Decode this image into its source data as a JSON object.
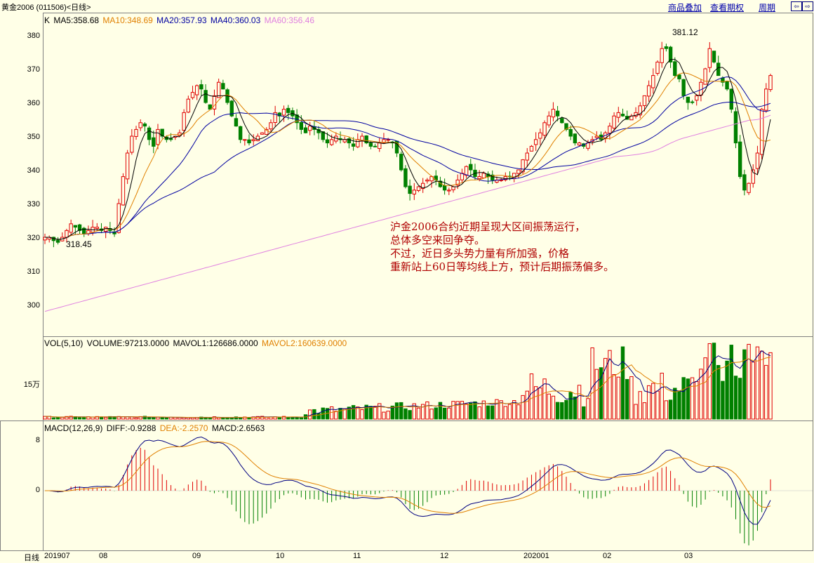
{
  "header": {
    "title": "黄金2006 (011506)<日线>",
    "links": [
      "商品叠加",
      "查看期权",
      "周期"
    ],
    "nav_prev": "⇦",
    "nav_next": "⇨"
  },
  "colors": {
    "background": "#FFFFE7",
    "up": "#E00000",
    "down": "#008000",
    "ma5": "#000000",
    "ma10": "#E08000",
    "ma20": "#0000A0",
    "ma40": "#0000A0",
    "ma60": "#E080E0"
  },
  "price_panel": {
    "legend": {
      "k": "K",
      "ma5": "MA5:358.68",
      "ma10": "MA10:348.69",
      "ma20": "MA20:357.93",
      "ma40": "MA40:360.03",
      "ma60": "MA60:356.46"
    },
    "yticks": [
      "380",
      "370",
      "360",
      "350",
      "340",
      "330",
      "320",
      "310",
      "300"
    ],
    "high_label": "381.12",
    "low_label": "318.45",
    "annotation": [
      "沪金2006合约近期呈现大区间振荡运行，",
      "总体多空来回争夺。",
      "不过，近日多头势力量有所加强，价格",
      "重新站上60日等均线上方，预计后期振荡偏多。"
    ]
  },
  "volume_panel": {
    "legend": {
      "vol": "VOL(5,10)",
      "volume": "VOLUME:97213.0000",
      "mavol1": "MAVOL1:126686.0000",
      "mavol2": "MAVOL2:160639.0000"
    },
    "ytick": "15万"
  },
  "macd_panel": {
    "legend": {
      "macd_name": "MACD(12,26,9)",
      "diff": "DIFF:-0.9288",
      "dea": "DEA:-2.2570",
      "macd": "MACD:2.6563"
    },
    "yticks": [
      "8",
      "0"
    ]
  },
  "xaxis": {
    "period_label": "日线",
    "ticks": [
      "201907",
      "08",
      "09",
      "10",
      "11",
      "12",
      "202001",
      "02",
      "03"
    ]
  },
  "chart_data": {
    "type": "candlestick",
    "ylim": [
      294,
      384
    ],
    "y_ticks": [
      300,
      310,
      320,
      330,
      340,
      350,
      360,
      370,
      380
    ],
    "annotations": {
      "high": 381.12,
      "low": 318.45
    },
    "month_start_index": [
      0,
      17,
      42,
      65,
      87,
      110,
      133,
      154,
      174
    ],
    "last_values": {
      "ma5": 358.68,
      "ma10": 348.69,
      "ma20": 357.93,
      "ma40": 360.03,
      "ma60": 356.46,
      "volume": 97213,
      "mavol1": 126686,
      "mavol2": 160639,
      "diff": -0.9288,
      "dea": -2.257,
      "macd": 2.6563
    },
    "close_path": [
      320,
      320,
      319,
      318.5,
      320,
      322,
      324,
      323,
      322,
      321,
      322,
      323,
      323,
      322,
      323,
      322,
      321,
      330,
      338,
      345,
      350,
      352,
      354,
      353,
      349,
      347,
      352,
      350,
      349,
      349,
      350,
      351,
      357,
      361,
      363,
      365,
      364,
      360,
      358,
      362,
      366,
      364,
      360,
      356,
      353,
      349,
      349,
      348,
      349,
      350,
      351,
      352,
      354,
      357,
      356,
      358,
      357,
      356,
      354,
      352,
      351,
      353,
      352,
      351,
      349,
      348,
      349,
      350,
      349,
      349,
      348,
      347,
      349,
      350,
      348,
      347,
      347,
      348,
      349,
      349,
      348,
      345,
      340,
      335,
      333,
      334,
      335,
      336,
      337,
      338,
      337,
      335,
      334,
      334,
      335,
      337,
      339,
      341,
      340,
      338,
      338,
      339,
      338,
      337,
      337,
      337,
      338,
      338,
      339,
      340,
      343,
      345,
      347,
      349,
      351,
      354,
      356,
      358,
      356,
      354,
      352,
      350,
      348,
      348,
      347,
      348,
      349,
      350,
      349,
      351,
      353,
      356,
      357,
      356,
      355,
      356,
      357,
      359,
      362,
      365,
      368,
      372,
      376,
      376,
      372,
      368,
      367,
      362,
      360,
      360,
      362,
      366,
      370,
      376,
      372,
      368,
      366,
      364,
      358,
      348,
      338,
      334,
      336,
      340,
      345,
      358,
      364,
      368
    ]
  }
}
